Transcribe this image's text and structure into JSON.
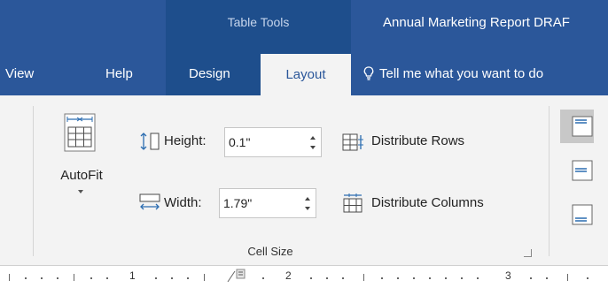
{
  "window": {
    "contextual_group": "Table Tools",
    "doc_title": "Annual Marketing Report DRAF"
  },
  "tabs": [
    {
      "label": "View"
    },
    {
      "label": "Help"
    },
    {
      "label": "Design"
    },
    {
      "label": "Layout",
      "active": true
    }
  ],
  "tell_me": "Tell me what you want to do",
  "cell_size": {
    "group_label": "Cell Size",
    "autofit_label": "AutoFit",
    "height_label": "Height:",
    "height_value": "0.1\"",
    "width_label": "Width:",
    "width_value": "1.79\"",
    "distribute_rows": "Distribute Rows",
    "distribute_columns": "Distribute Columns"
  },
  "ruler": {
    "numbers": [
      "1",
      "2",
      "3"
    ]
  },
  "colors": {
    "title_bar": "#2b579a",
    "contextual_band": "#1e4e8c",
    "ribbon_bg": "#f3f3f3",
    "accent": "#2b579a",
    "icon_blue": "#2b6cb0"
  }
}
